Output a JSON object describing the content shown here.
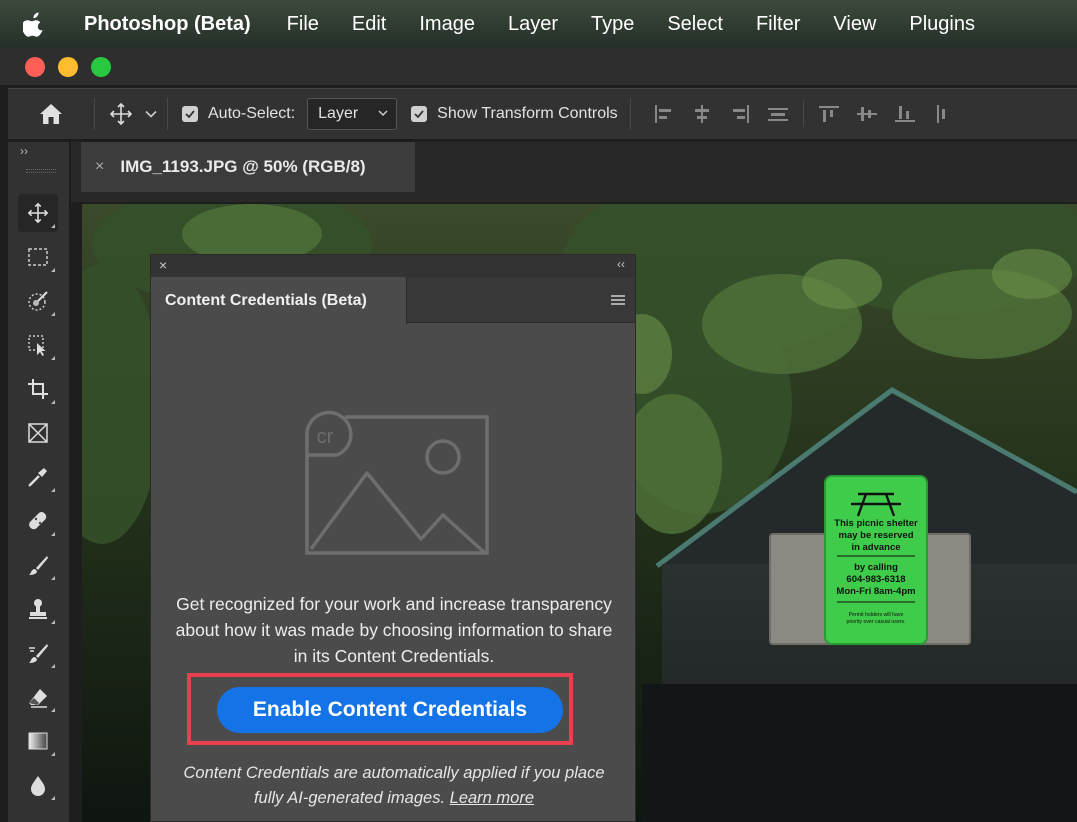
{
  "menubar": {
    "app_name": "Photoshop (Beta)",
    "items": [
      "File",
      "Edit",
      "Image",
      "Layer",
      "Type",
      "Select",
      "Filter",
      "View",
      "Plugins"
    ]
  },
  "options": {
    "auto_select_label": "Auto-Select:",
    "auto_select_checked": true,
    "auto_select_value": "Layer",
    "show_transform_label": "Show Transform Controls",
    "show_transform_checked": true
  },
  "toolbar": {
    "collapse_glyph": "››",
    "tools": [
      "move-tool-icon",
      "marquee-tool-icon",
      "object-selection-tool-icon",
      "artboard-select-tool-icon",
      "crop-tool-icon",
      "frame-tool-icon",
      "eyedropper-tool-icon",
      "healing-brush-tool-icon",
      "brush-tool-icon",
      "clone-stamp-tool-icon",
      "history-brush-tool-icon",
      "eraser-tool-icon",
      "gradient-tool-icon",
      "blur-tool-icon"
    ]
  },
  "document": {
    "tab_close": "×",
    "tab_title": "IMG_1193.JPG @ 50% (RGB/8)"
  },
  "sign": {
    "lines": [
      "This picnic shelter",
      "may be reserved",
      "in advance",
      "by calling",
      "604-983-6318",
      "Mon-Fri 8am-4pm",
      "Permit holders will have",
      "priority over casual users."
    ]
  },
  "panel": {
    "close": "×",
    "collapse": "‹‹",
    "tab_title": "Content Credentials (Beta)",
    "illustration_badge": "cr",
    "description": "Get recognized for your work and increase transparency about how it was made by choosing information to share in its Content Credentials.",
    "enable_button": "Enable Content Credentials",
    "note_text": "Content Credentials are automatically applied if you place fully AI-generated images.",
    "learn_more": "Learn more"
  },
  "colors": {
    "accent_button": "#1473e6",
    "highlight_box": "#e8404e",
    "sign_green": "#3fcc4a"
  }
}
